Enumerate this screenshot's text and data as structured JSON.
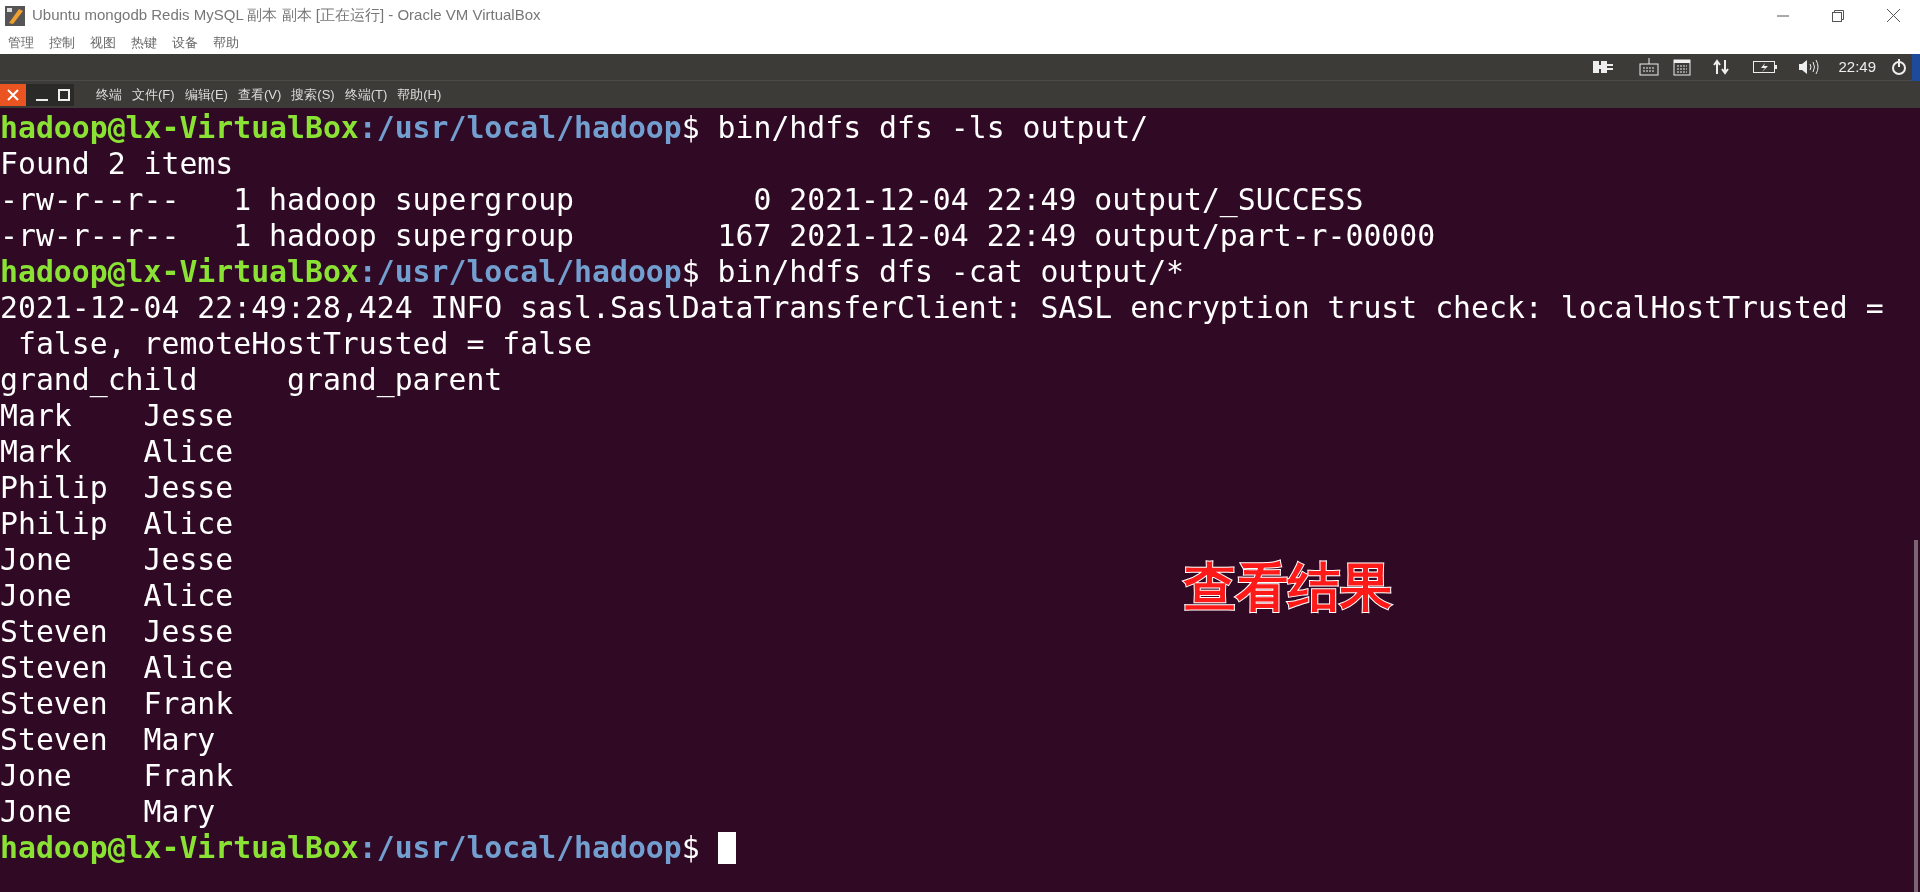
{
  "window": {
    "title": "Ubuntu mongodb Redis MySQL 副本 副本 [正在运行] - Oracle VM VirtualBox"
  },
  "vm_menu": [
    "管理",
    "控制",
    "视图",
    "热键",
    "设备",
    "帮助"
  ],
  "top_panel": {
    "clock": "22:49"
  },
  "terminal_menu": [
    "终端",
    "文件(F)",
    "编辑(E)",
    "查看(V)",
    "搜索(S)",
    "终端(T)",
    "帮助(H)"
  ],
  "terminal_lines": [
    {
      "kind": "prompt",
      "user": "hadoop@lx-VirtualBox",
      "path": ":/usr/local/hadoop",
      "command": "$ bin/hdfs dfs -ls output/"
    },
    {
      "kind": "output",
      "text": "Found 2 items"
    },
    {
      "kind": "output",
      "text": "-rw-r--r--   1 hadoop supergroup          0 2021-12-04 22:49 output/_SUCCESS"
    },
    {
      "kind": "output",
      "text": "-rw-r--r--   1 hadoop supergroup        167 2021-12-04 22:49 output/part-r-00000"
    },
    {
      "kind": "prompt",
      "user": "hadoop@lx-VirtualBox",
      "path": ":/usr/local/hadoop",
      "command": "$ bin/hdfs dfs -cat output/*"
    },
    {
      "kind": "output",
      "text": "2021-12-04 22:49:28,424 INFO sasl.SaslDataTransferClient: SASL encryption trust check: localHostTrusted ="
    },
    {
      "kind": "output",
      "text": " false, remoteHostTrusted = false"
    },
    {
      "kind": "output",
      "text": "grand_child     grand_parent"
    },
    {
      "kind": "output",
      "text": "Mark    Jesse"
    },
    {
      "kind": "output",
      "text": "Mark    Alice"
    },
    {
      "kind": "output",
      "text": "Philip  Jesse"
    },
    {
      "kind": "output",
      "text": "Philip  Alice"
    },
    {
      "kind": "output",
      "text": "Jone    Jesse"
    },
    {
      "kind": "output",
      "text": "Jone    Alice"
    },
    {
      "kind": "output",
      "text": "Steven  Jesse"
    },
    {
      "kind": "output",
      "text": "Steven  Alice"
    },
    {
      "kind": "output",
      "text": "Steven  Frank"
    },
    {
      "kind": "output",
      "text": "Steven  Mary"
    },
    {
      "kind": "output",
      "text": "Jone    Frank"
    },
    {
      "kind": "output",
      "text": "Jone    Mary"
    },
    {
      "kind": "prompt",
      "user": "hadoop@lx-VirtualBox",
      "path": ":/usr/local/hadoop",
      "command": "$ ",
      "cursor": true
    }
  ],
  "annotation": "查看结果"
}
